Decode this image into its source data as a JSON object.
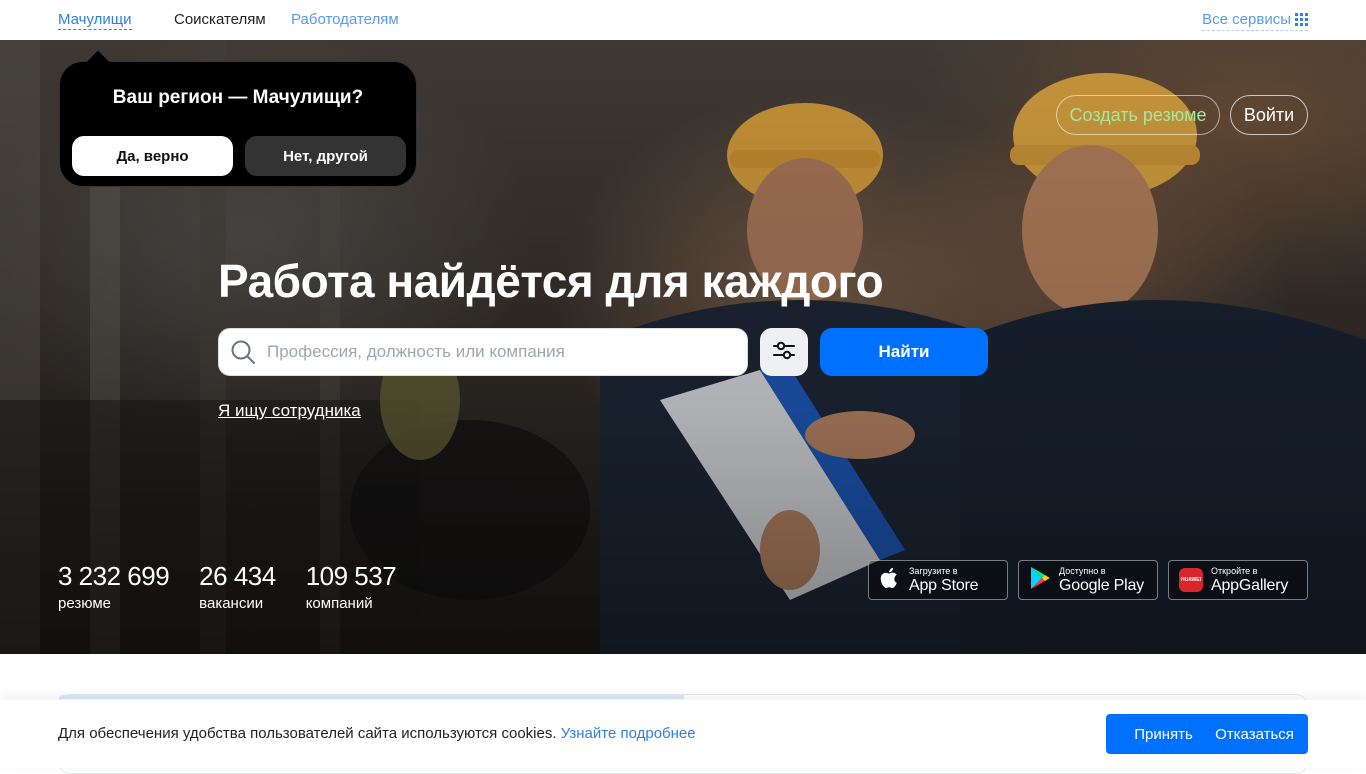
{
  "nav": {
    "region": "Мачулищи",
    "seekers": "Соискателям",
    "employers": "Работодателям",
    "all_services": "Все сервисы"
  },
  "region_popup": {
    "question": "Ваш регион — Мачулищи?",
    "yes": "Да, верно",
    "no": "Нет, другой"
  },
  "header_actions": {
    "create_resume": "Создать резюме",
    "login": "Войти"
  },
  "hero": {
    "headline": "Работа найдётся для каждого",
    "search_placeholder": "Профессия, должность или компания",
    "search_value": "",
    "find": "Найти",
    "employer_link": "Я ищу сотрудника"
  },
  "stats": [
    {
      "value": "3 232 699",
      "label": "резюме"
    },
    {
      "value": "26 434",
      "label": "вакансии"
    },
    {
      "value": "109 537",
      "label": "компаний"
    }
  ],
  "stores": {
    "appstore": {
      "small": "Загрузите в",
      "big": "App Store"
    },
    "googleplay": {
      "small": "Доступно в",
      "big": "Google Play"
    },
    "appgallery": {
      "small": "Откройте в",
      "big": "AppGallery",
      "badge": "HUAWEI"
    }
  },
  "cookie": {
    "message": "Для обеспечения удобства пользователей сайта используются cookies.",
    "learn_more": "Узнайте подробнее",
    "accept": "Принять",
    "decline": "Отказаться"
  },
  "colors": {
    "accent": "#0070ff",
    "link": "#2f80e0",
    "resume_text": "#a8e6a0"
  }
}
